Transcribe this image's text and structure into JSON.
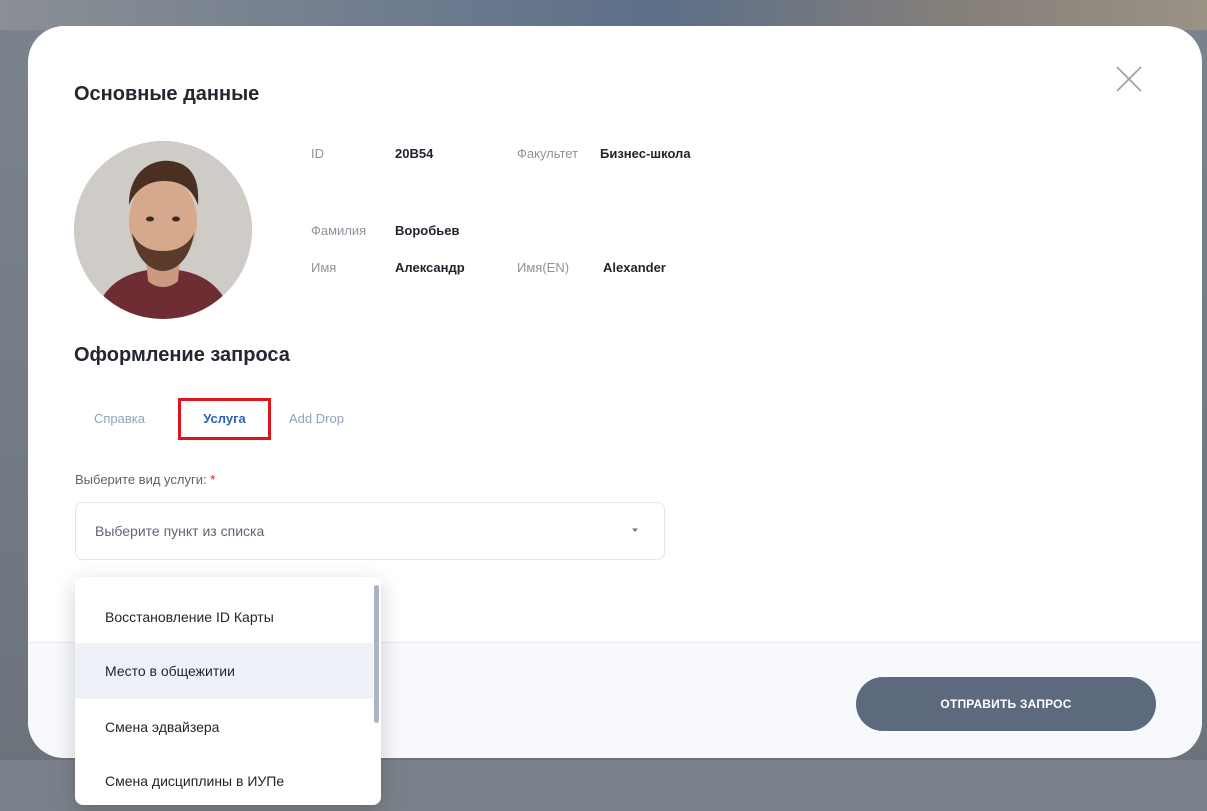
{
  "modal": {
    "main_section_title": "Основные данные",
    "request_section_title": "Оформление запроса"
  },
  "profile": {
    "id_label": "ID",
    "id_value": "20B54",
    "faculty_label": "Факультет",
    "faculty_value": "Бизнес-школа",
    "surname_label": "Фамилия",
    "surname_value": "Воробьев",
    "name_label": "Имя",
    "name_value": "Александр",
    "name_en_label": "Имя(EN)",
    "name_en_value": "Alexander"
  },
  "tabs": [
    {
      "label": "Справка",
      "active": false
    },
    {
      "label": "Услуга",
      "active": true
    },
    {
      "label": "Add Drop",
      "active": false
    }
  ],
  "service_field": {
    "label": "Выберите вид услуги:",
    "required_mark": "*",
    "placeholder": "Выберите пункт из списка"
  },
  "dropdown": {
    "options": [
      "Восстановление ID Карты",
      "Место в общежитии",
      "Смена эдвайзера",
      "Смена дисциплины в ИУПе"
    ],
    "hovered_index": 1
  },
  "submit": {
    "label": "ОТПРАВИТЬ ЗАПРОС"
  },
  "icons": {
    "close": "close-icon",
    "caret": "caret-down-icon",
    "avatar": "user-avatar"
  },
  "colors": {
    "accent": "#2a63b8",
    "highlight_border": "#e0141c",
    "button": "#5d6a7e",
    "tab_inactive": "#93a3bd"
  }
}
